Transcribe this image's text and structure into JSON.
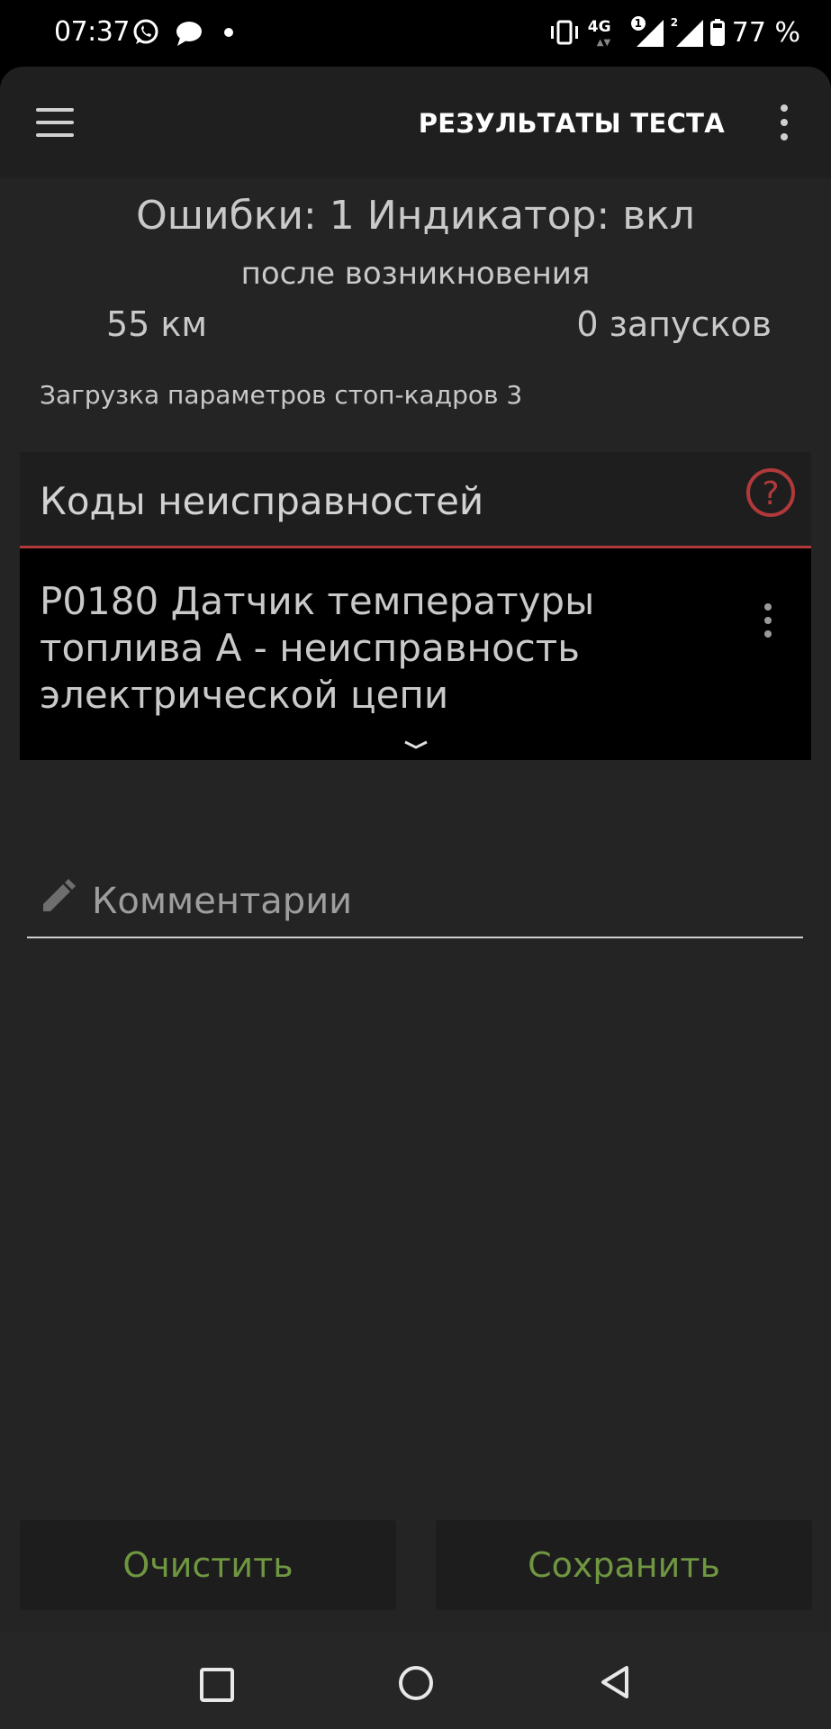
{
  "status_bar": {
    "time": "07:37",
    "battery_percent": "77 %",
    "network": "4G",
    "sim1_badge": "1",
    "sim2_badge": "2",
    "icons": [
      "whatsapp-icon",
      "message-icon",
      "dot-icon",
      "vibrate-icon",
      "signal-icon",
      "battery-icon"
    ]
  },
  "app_bar": {
    "title": "РЕЗУЛЬТАТЫ ТЕСТА",
    "menu_icon": "hamburger-menu-icon",
    "overflow_icon": "more-vert-icon"
  },
  "summary": {
    "errors_line": "Ошибки: 1 Индикатор: вкл",
    "since_label": "после возникновения",
    "km": "55 км",
    "starts": "0 запусков",
    "freeze_frames": "Загрузка параметров стоп-кадров 3"
  },
  "dtc": {
    "header": "Коды неисправностей",
    "accent_color": "#b2393b",
    "items": [
      {
        "text": "P0180 Датчик температуры топлива A - неисправность электрической цепи"
      }
    ]
  },
  "comment": {
    "placeholder": "Комментарии"
  },
  "actions": {
    "clear_label": "Очистить",
    "save_label": "Сохранить",
    "label_color": "#6f9640"
  },
  "nav_bar": {
    "icons": [
      "recents-icon",
      "home-icon",
      "back-icon"
    ]
  }
}
